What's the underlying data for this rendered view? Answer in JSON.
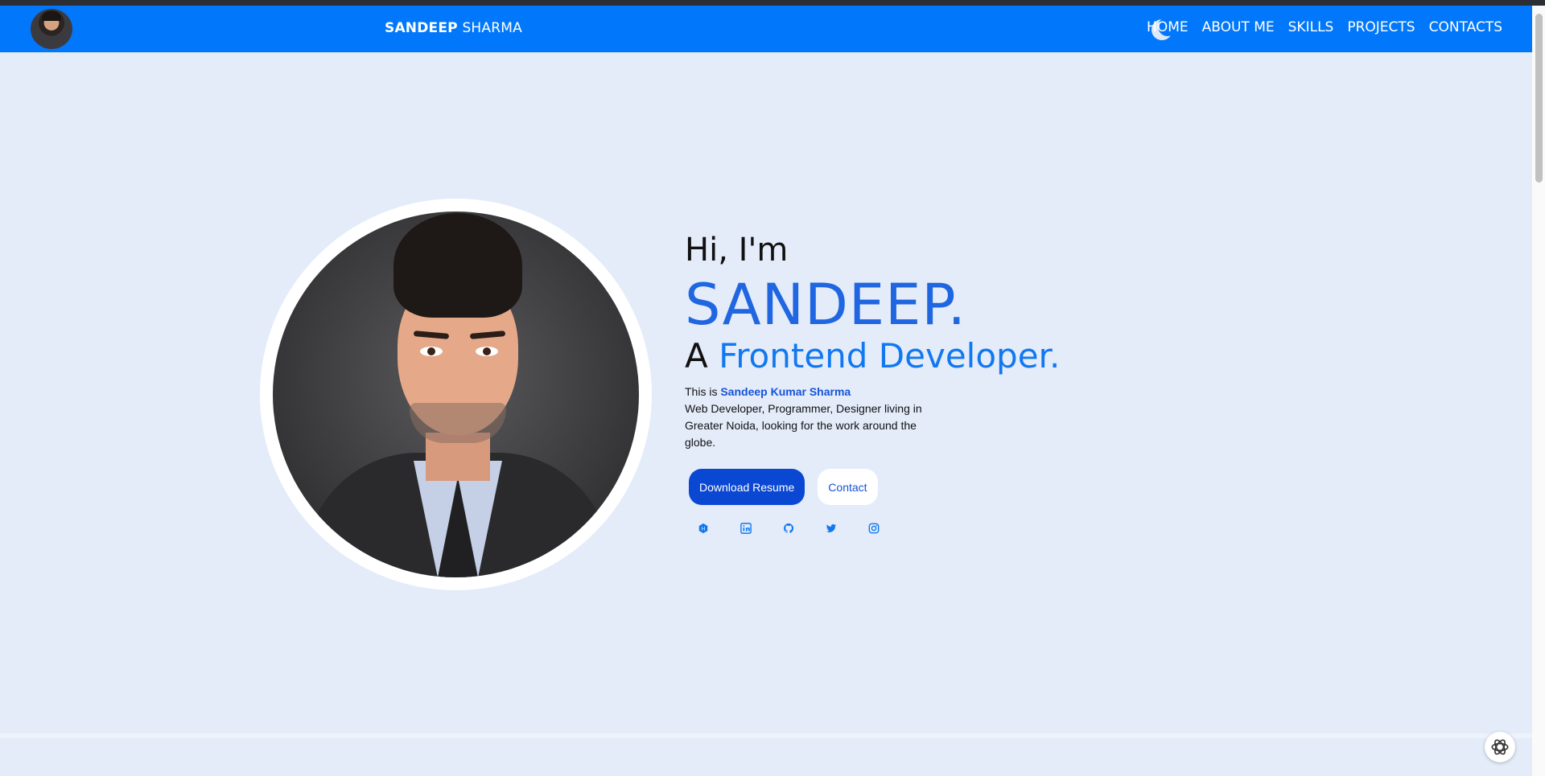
{
  "navbar": {
    "brand_first": "SANDEEP",
    "brand_last": "SHARMA",
    "links": [
      "HOME",
      "ABOUT ME",
      "SKILLS",
      "PROJECTS",
      "CONTACTS"
    ],
    "background": "#0178fb"
  },
  "hero": {
    "greeting": "Hi, I'm",
    "name": "SANDEEP.",
    "role_prefix": "A",
    "role": "Frontend Developer.",
    "bio_intro": "This is",
    "bio_name": "Sandeep Kumar Sharma",
    "bio_rest": "Web Developer, Programmer, Designer living in Greater Noida, looking for the work around the globe.",
    "download_button": "Download Resume",
    "contact_button": "Contact",
    "socials": [
      "hackerrank-icon",
      "linkedin-icon",
      "github-icon",
      "twitter-icon",
      "instagram-icon"
    ]
  },
  "colors": {
    "accent": "#1f66e0",
    "primary_button": "#0a48d4",
    "page_background": "#e4ecfa"
  }
}
